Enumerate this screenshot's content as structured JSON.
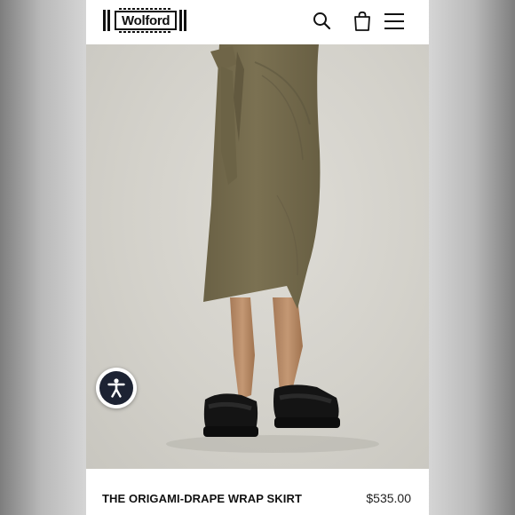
{
  "header": {
    "brand": "Wolford",
    "icons": [
      "search-icon",
      "shopping-bag-icon",
      "hamburger-menu-icon"
    ]
  },
  "hero": {
    "accessibility_icon": "accessibility-icon"
  },
  "product": {
    "name": "THE ORIGAMI-DRAPE WRAP SKIRT",
    "price": "$535.00"
  },
  "colors": {
    "skirt": "#756b4d",
    "background": "#d6d4ce",
    "accessibility_button": "#1d2333"
  }
}
